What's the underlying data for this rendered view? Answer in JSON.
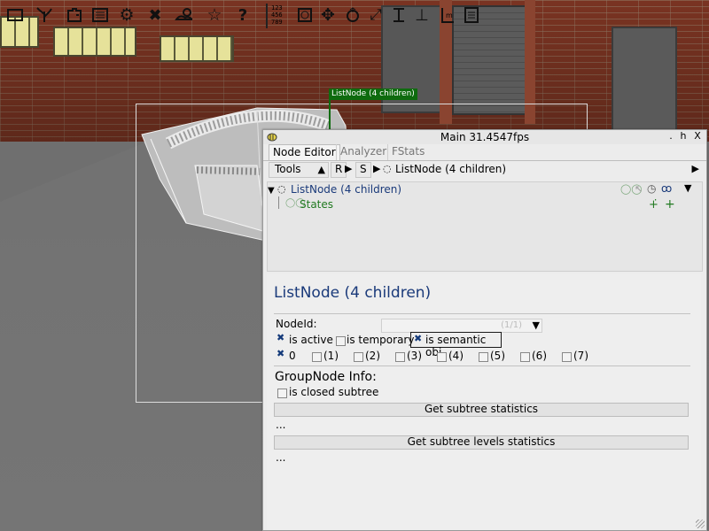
{
  "scene": {
    "node_label": "ListNode (4 children)"
  },
  "toolbar": {
    "buttons": [
      "new-scene",
      "tree-tool",
      "puzzle-tool",
      "list-tool",
      "settings",
      "tools",
      "weather",
      "favorites",
      "help"
    ],
    "grid_label": "123\n456\n789",
    "tool_buttons": [
      "object-tool",
      "move-tool",
      "rotate-tool",
      "scale-tool",
      "align-tool",
      "anchor-tool",
      "measure-tool",
      "notes-tool"
    ]
  },
  "window": {
    "title": "Main 31.4547fps",
    "controls": [
      ".",
      "h",
      "X"
    ],
    "tabs": [
      "Node Editor",
      "Analyzer",
      "FStats"
    ],
    "active_tab": "Node Editor"
  },
  "pathbar": {
    "tools_label": "Tools",
    "r_label": "R",
    "s_label": "S",
    "current_node": "ListNode (4 children)"
  },
  "tree": {
    "root": "ListNode (4 children)",
    "child": "States"
  },
  "inspector": {
    "title": "ListNode (4 children)",
    "nodeid_label": "NodeId:",
    "nodeid_value": "(1/1)",
    "is_active": "is active",
    "is_temporary": "is temporary",
    "is_semantic": "is semantic obj",
    "flags": [
      "0",
      "(1)",
      "(2)",
      "(3)",
      "(4)",
      "(5)",
      "(6)",
      "(7)"
    ],
    "group_header": "GroupNode Info:",
    "closed_subtree": "is closed subtree",
    "subtree_stats_button": "Get subtree statistics",
    "subtree_stats_result": "...",
    "levels_stats_button": "Get subtree levels statistics",
    "levels_stats_result": "..."
  }
}
